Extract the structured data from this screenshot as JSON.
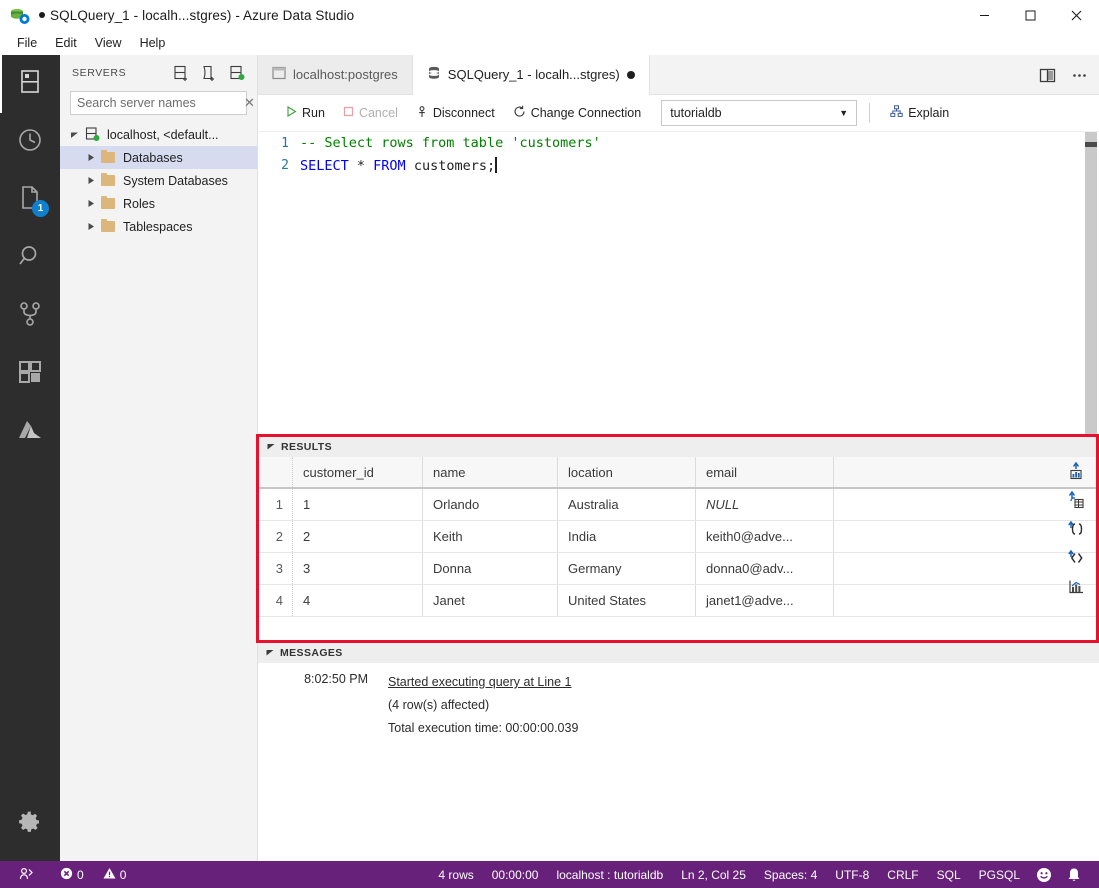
{
  "window": {
    "title": "SQLQuery_1 - localh...stgres) - Azure Data Studio",
    "dirty_marker": "●",
    "minimize": "─",
    "maximize": "☐",
    "close": "✕",
    "accent_purple": "#68217a",
    "highlight_red": "#e8112d"
  },
  "menubar": {
    "items": [
      {
        "label": "File"
      },
      {
        "label": "Edit"
      },
      {
        "label": "View"
      },
      {
        "label": "Help"
      }
    ]
  },
  "activitybar": {
    "items": [
      {
        "name": "servers-icon",
        "label": "Servers",
        "active": true
      },
      {
        "name": "history-icon",
        "label": "Query History",
        "active": false
      },
      {
        "name": "notebooks-icon",
        "label": "Notebooks",
        "active": false,
        "badge": "1"
      },
      {
        "name": "search-icon",
        "label": "Search",
        "active": false
      },
      {
        "name": "source-control-icon",
        "label": "Source Control",
        "active": false
      },
      {
        "name": "extensions-icon",
        "label": "Extensions",
        "active": false
      },
      {
        "name": "azure-icon",
        "label": "Azure",
        "active": false
      }
    ],
    "settings": {
      "name": "gear-icon",
      "label": "Manage"
    }
  },
  "sidebar": {
    "title": "SERVERS",
    "actions": [
      {
        "name": "new-connection-icon",
        "label": "New Connection"
      },
      {
        "name": "new-server-group-icon",
        "label": "New Server Group"
      },
      {
        "name": "show-active-connections-icon",
        "label": "Show Active Connections"
      }
    ],
    "search": {
      "placeholder": "Search server names",
      "value": "",
      "clear": "✕"
    },
    "tree": [
      {
        "label": "localhost, <default...",
        "level": 0,
        "expanded": true,
        "icon": "server-icon",
        "selected": false
      },
      {
        "label": "Databases",
        "level": 1,
        "expanded": false,
        "icon": "folder-icon",
        "selected": true
      },
      {
        "label": "System Databases",
        "level": 1,
        "expanded": false,
        "icon": "folder-icon",
        "selected": false
      },
      {
        "label": "Roles",
        "level": 1,
        "expanded": false,
        "icon": "folder-icon",
        "selected": false
      },
      {
        "label": "Tablespaces",
        "level": 1,
        "expanded": false,
        "icon": "folder-icon",
        "selected": false
      }
    ]
  },
  "tabs": [
    {
      "label": "localhost:postgres",
      "active": false,
      "dirty": false,
      "icon": "dashboard-icon"
    },
    {
      "label": "SQLQuery_1 - localh...stgres)",
      "active": true,
      "dirty": true,
      "icon": "database-icon"
    }
  ],
  "editor_actions": [
    {
      "name": "split-editor-icon",
      "label": "Split Editor"
    },
    {
      "name": "more-actions-icon",
      "label": "More Actions...",
      "glyph": "•••"
    }
  ],
  "query_toolbar": {
    "run": {
      "label": "Run",
      "disabled": false
    },
    "cancel": {
      "label": "Cancel",
      "disabled": true
    },
    "disconnect": {
      "label": "Disconnect",
      "disabled": false
    },
    "change_connection": {
      "label": "Change Connection",
      "disabled": false
    },
    "database_select": {
      "value": "tutorialdb",
      "caret": "▼"
    },
    "explain": {
      "label": "Explain",
      "disabled": false
    }
  },
  "editor": {
    "lines": [
      {
        "number": "1",
        "tokens": [
          {
            "text": "-- Select rows from table 'customers'",
            "type": "comment"
          }
        ]
      },
      {
        "number": "2",
        "tokens": [
          {
            "text": "SELECT",
            "type": "kw"
          },
          {
            "text": " * ",
            "type": "plain"
          },
          {
            "text": "FROM",
            "type": "kw"
          },
          {
            "text": " customers;",
            "type": "plain"
          }
        ]
      }
    ]
  },
  "results": {
    "panel_title": "RESULTS",
    "twisty": "◢",
    "columns": [
      "customer_id",
      "name",
      "location",
      "email"
    ],
    "rows": [
      {
        "num": "1",
        "customer_id": "1",
        "name": "Orlando",
        "location": "Australia",
        "email": "NULL",
        "email_is_null": true
      },
      {
        "num": "2",
        "customer_id": "2",
        "name": "Keith",
        "location": "India",
        "email": "keith0@adve...",
        "email_is_null": false
      },
      {
        "num": "3",
        "customer_id": "3",
        "name": "Donna",
        "location": "Germany",
        "email": "donna0@adv...",
        "email_is_null": false
      },
      {
        "num": "4",
        "customer_id": "4",
        "name": "Janet",
        "location": "United States",
        "email": "janet1@adve...",
        "email_is_null": false
      }
    ],
    "export_actions": [
      {
        "name": "save-as-excel-icon",
        "label": "Save As Excel"
      },
      {
        "name": "save-as-csv-icon",
        "label": "Save As CSV"
      },
      {
        "name": "save-as-json-icon",
        "label": "Save As JSON"
      },
      {
        "name": "save-as-xml-icon",
        "label": "Save As XML"
      },
      {
        "name": "view-as-chart-icon",
        "label": "View As Chart"
      }
    ]
  },
  "messages": {
    "panel_title": "MESSAGES",
    "twisty": "◢",
    "time": "8:02:50 PM",
    "lines": [
      {
        "text": "Started executing query at Line 1",
        "link": true
      },
      {
        "text": "(4 row(s) affected)",
        "link": false
      },
      {
        "text": "Total execution time: 00:00:00.039",
        "link": false
      }
    ]
  },
  "statusbar": {
    "remote_icon": "remote-connection-icon",
    "errors": {
      "icon": "error-icon",
      "count": "0"
    },
    "warnings": {
      "icon": "warning-icon",
      "count": "0"
    },
    "right_items": [
      {
        "name": "row-count",
        "label": "4 rows"
      },
      {
        "name": "execution-time",
        "label": "00:00:00"
      },
      {
        "name": "connection-info",
        "label": "localhost : tutorialdb"
      },
      {
        "name": "cursor-position",
        "label": "Ln 2, Col 25"
      },
      {
        "name": "indentation",
        "label": "Spaces: 4"
      },
      {
        "name": "encoding",
        "label": "UTF-8"
      },
      {
        "name": "line-endings",
        "label": "CRLF"
      },
      {
        "name": "language-mode",
        "label": "SQL"
      },
      {
        "name": "provider",
        "label": "PGSQL"
      }
    ],
    "feedback_icon": "smiley-icon",
    "notifications_icon": "bell-icon"
  }
}
